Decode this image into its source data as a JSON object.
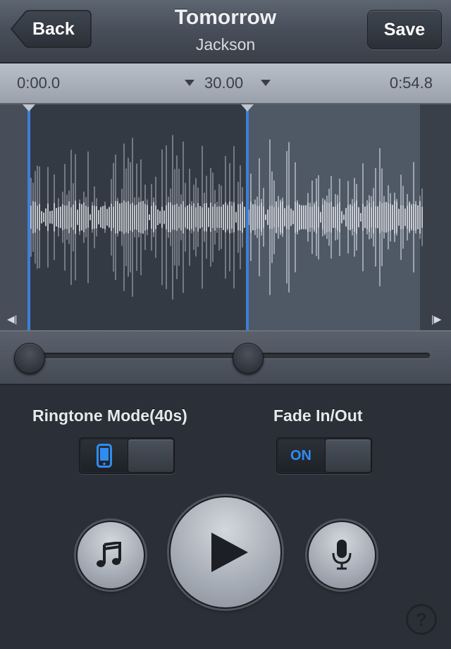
{
  "navbar": {
    "back_label": "Back",
    "title": "Tomorrow",
    "subtitle": "Jackson",
    "save_label": "Save"
  },
  "timebar": {
    "start_time": "0:00.0",
    "duration": "30.00",
    "end_time": "0:54.8"
  },
  "selection": {
    "start_fraction": 0.0,
    "end_fraction": 0.547
  },
  "controls": {
    "ringtone_mode_label": "Ringtone Mode(40s)",
    "ringtone_mode_icon": "phone-icon",
    "fade_label": "Fade In/Out",
    "fade_state": "ON"
  },
  "buttons": {
    "music_icon": "music-note-icon",
    "play_icon": "play-icon",
    "mic_icon": "microphone-icon",
    "help_icon": "help-icon",
    "help_text": "?"
  },
  "colors": {
    "accent": "#2f8cf0",
    "handle_line": "#3d7fd9",
    "selected_region": "#343a44",
    "unselected_region": "#4f5865",
    "waveform": "#c3c9d2"
  }
}
